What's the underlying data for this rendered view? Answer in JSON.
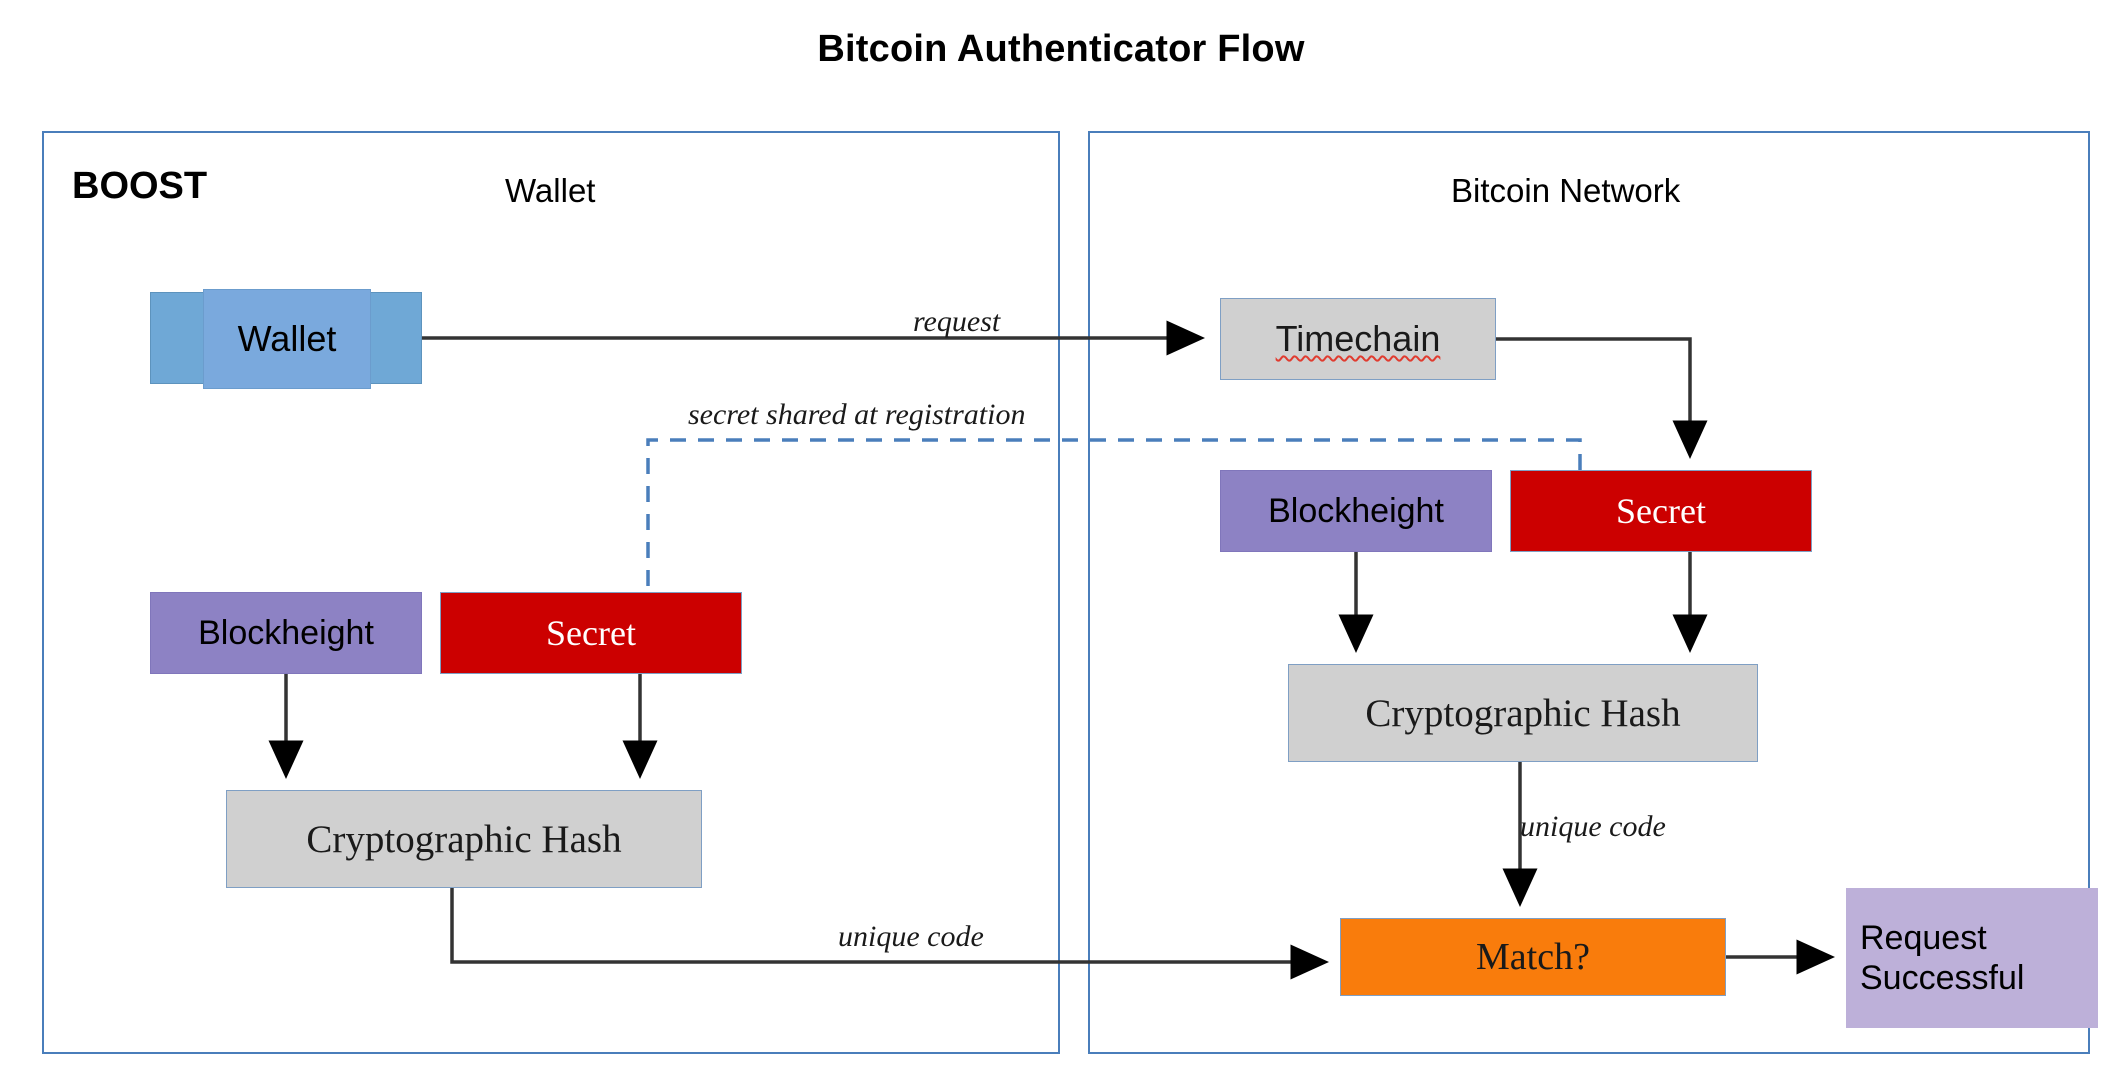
{
  "title": "Bitcoin Authenticator Flow",
  "panels": {
    "wallet": {
      "brand": "BOOST",
      "heading": "Wallet"
    },
    "network": {
      "heading": "Bitcoin Network"
    }
  },
  "nodes": {
    "wallet": "Wallet",
    "timechain": "Timechain",
    "blockheight_left": "Blockheight",
    "secret_left": "Secret",
    "hash_left": "Cryptographic Hash",
    "blockheight_right": "Blockheight",
    "secret_right": "Secret",
    "hash_right": "Cryptographic Hash",
    "match": "Match?",
    "request_line1": "Request",
    "request_line2": "Successful"
  },
  "edge_labels": {
    "request": "request",
    "secret_shared": "secret shared at registration",
    "unique_code_left": "unique code",
    "unique_code_right": "unique code"
  },
  "colors": {
    "panel_border": "#4a7ebb",
    "wallet_side": "#6fa8d6",
    "wallet_center": "#7aa9dd",
    "purple": "#8d82c4",
    "red": "#cc0000",
    "gray": "#d0d0d0",
    "orange": "#f97c0c",
    "lilac": "#bdb0d9",
    "dashed_edge": "#4a7ebb",
    "solid_edge": "#333333",
    "spellcheck_underline": "#e03b2f"
  }
}
